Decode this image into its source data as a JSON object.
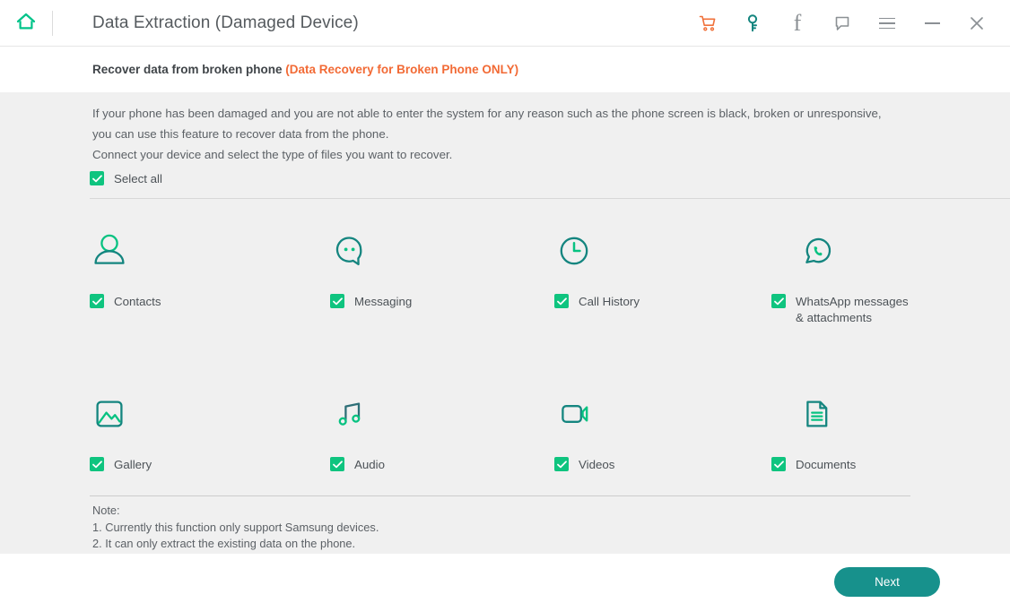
{
  "window": {
    "title": "Data Extraction (Damaged Device)",
    "home_icon": "home-icon",
    "actions": [
      {
        "name": "cart-icon",
        "label": "",
        "color": "#f0713a"
      },
      {
        "name": "key-icon",
        "label": "",
        "color": "#14857f"
      },
      {
        "name": "facebook-icon",
        "label": "f",
        "color": "#8b9094"
      },
      {
        "name": "feedback-icon",
        "label": "",
        "color": "#8b9094"
      },
      {
        "name": "menu-icon",
        "label": "",
        "color": "#8b9094"
      },
      {
        "name": "minimize-icon",
        "label": "",
        "color": "#8b9094"
      },
      {
        "name": "close-icon",
        "label": "✕",
        "color": "#8b9094"
      }
    ]
  },
  "subheader": {
    "title": "Recover data from broken phone ",
    "accent": "(Data Recovery for Broken Phone ONLY)",
    "accent_color": "#f26a35"
  },
  "main": {
    "description_line1": "If your phone has been damaged and you are not able to enter the system for any reason such as the phone screen is black, broken or unresponsive,",
    "description_line2": "you can use this feature to recover data from the phone.",
    "description_line3": "Connect your device and select the type of files you want to recover.",
    "select_all_label": "Select all",
    "select_all_checked": true,
    "checkbox_color": "#0fc47f"
  },
  "file_types": [
    {
      "id": "contacts",
      "label": "Contacts",
      "icon": "contact-icon",
      "checked": true
    },
    {
      "id": "messaging",
      "label": "Messaging",
      "icon": "message-icon",
      "checked": true
    },
    {
      "id": "call",
      "label": "Call History",
      "icon": "clock-icon",
      "checked": true
    },
    {
      "id": "whatsapp",
      "label": "WhatsApp messages\n& attachments",
      "icon": "whatsapp-icon",
      "checked": true
    },
    {
      "id": "gallery",
      "label": "Gallery",
      "icon": "image-icon",
      "checked": true
    },
    {
      "id": "audio",
      "label": "Audio",
      "icon": "music-icon",
      "checked": true
    },
    {
      "id": "videos",
      "label": "Videos",
      "icon": "video-icon",
      "checked": true
    },
    {
      "id": "documents",
      "label": "Documents",
      "icon": "document-icon",
      "checked": true
    }
  ],
  "note": {
    "heading": "Note:",
    "line1": "1. Currently this function only support Samsung devices.",
    "line2": "2. It can only extract the existing data on the phone."
  },
  "footer": {
    "next_label": "Next",
    "next_color": "#17918c"
  }
}
